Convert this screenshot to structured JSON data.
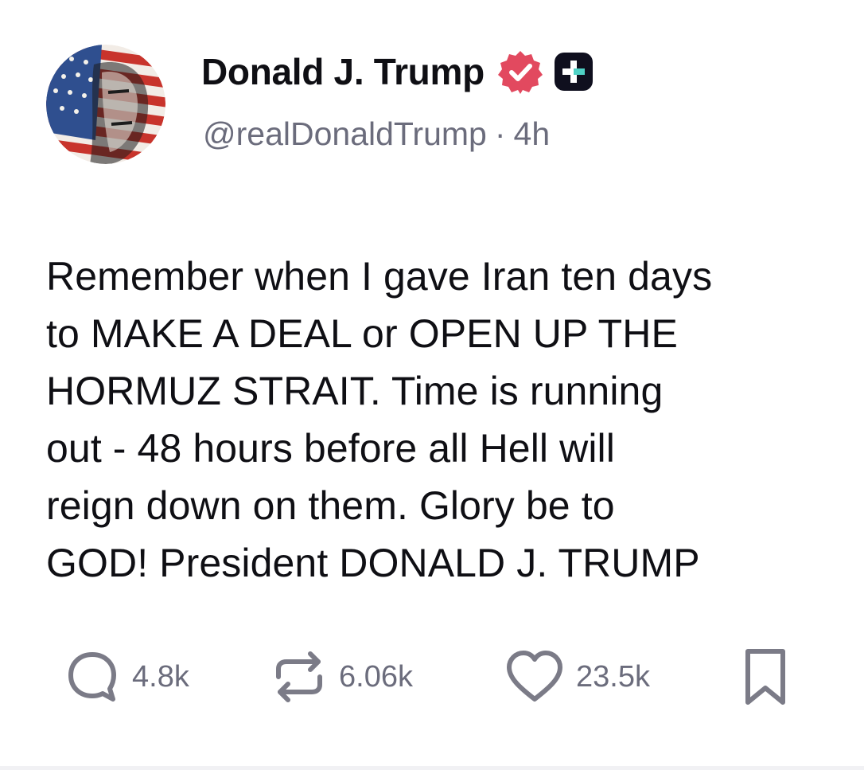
{
  "author": {
    "display_name": "Donald J. Trump",
    "handle": "@realDonaldTrump",
    "verified": true,
    "verified_badge_color": "#e2495f",
    "avatar_icon": "portrait-avatar-flag",
    "plus_badge_icon": "truth-plus-icon"
  },
  "meta": {
    "separator": "·",
    "time_ago": "4h"
  },
  "post": {
    "text": "Remember when I gave Iran ten days\nto MAKE A DEAL or OPEN UP THE\nHORMUZ STRAIT. Time is running\nout - 48 hours before all Hell will\nreign down on them. Glory be to\nGOD! President DONALD J. TRUMP"
  },
  "actions": {
    "reply": {
      "icon": "reply-bubble-icon",
      "count": "4.8k"
    },
    "retruth": {
      "icon": "repost-icon",
      "count": "6.06k"
    },
    "like": {
      "icon": "heart-icon",
      "count": "23.5k"
    },
    "bookmark": {
      "icon": "bookmark-icon"
    }
  },
  "colors": {
    "text_primary": "#0f0f14",
    "text_secondary": "#6b6c7c",
    "icon_gray": "#7b7b87",
    "background": "#ffffff"
  }
}
